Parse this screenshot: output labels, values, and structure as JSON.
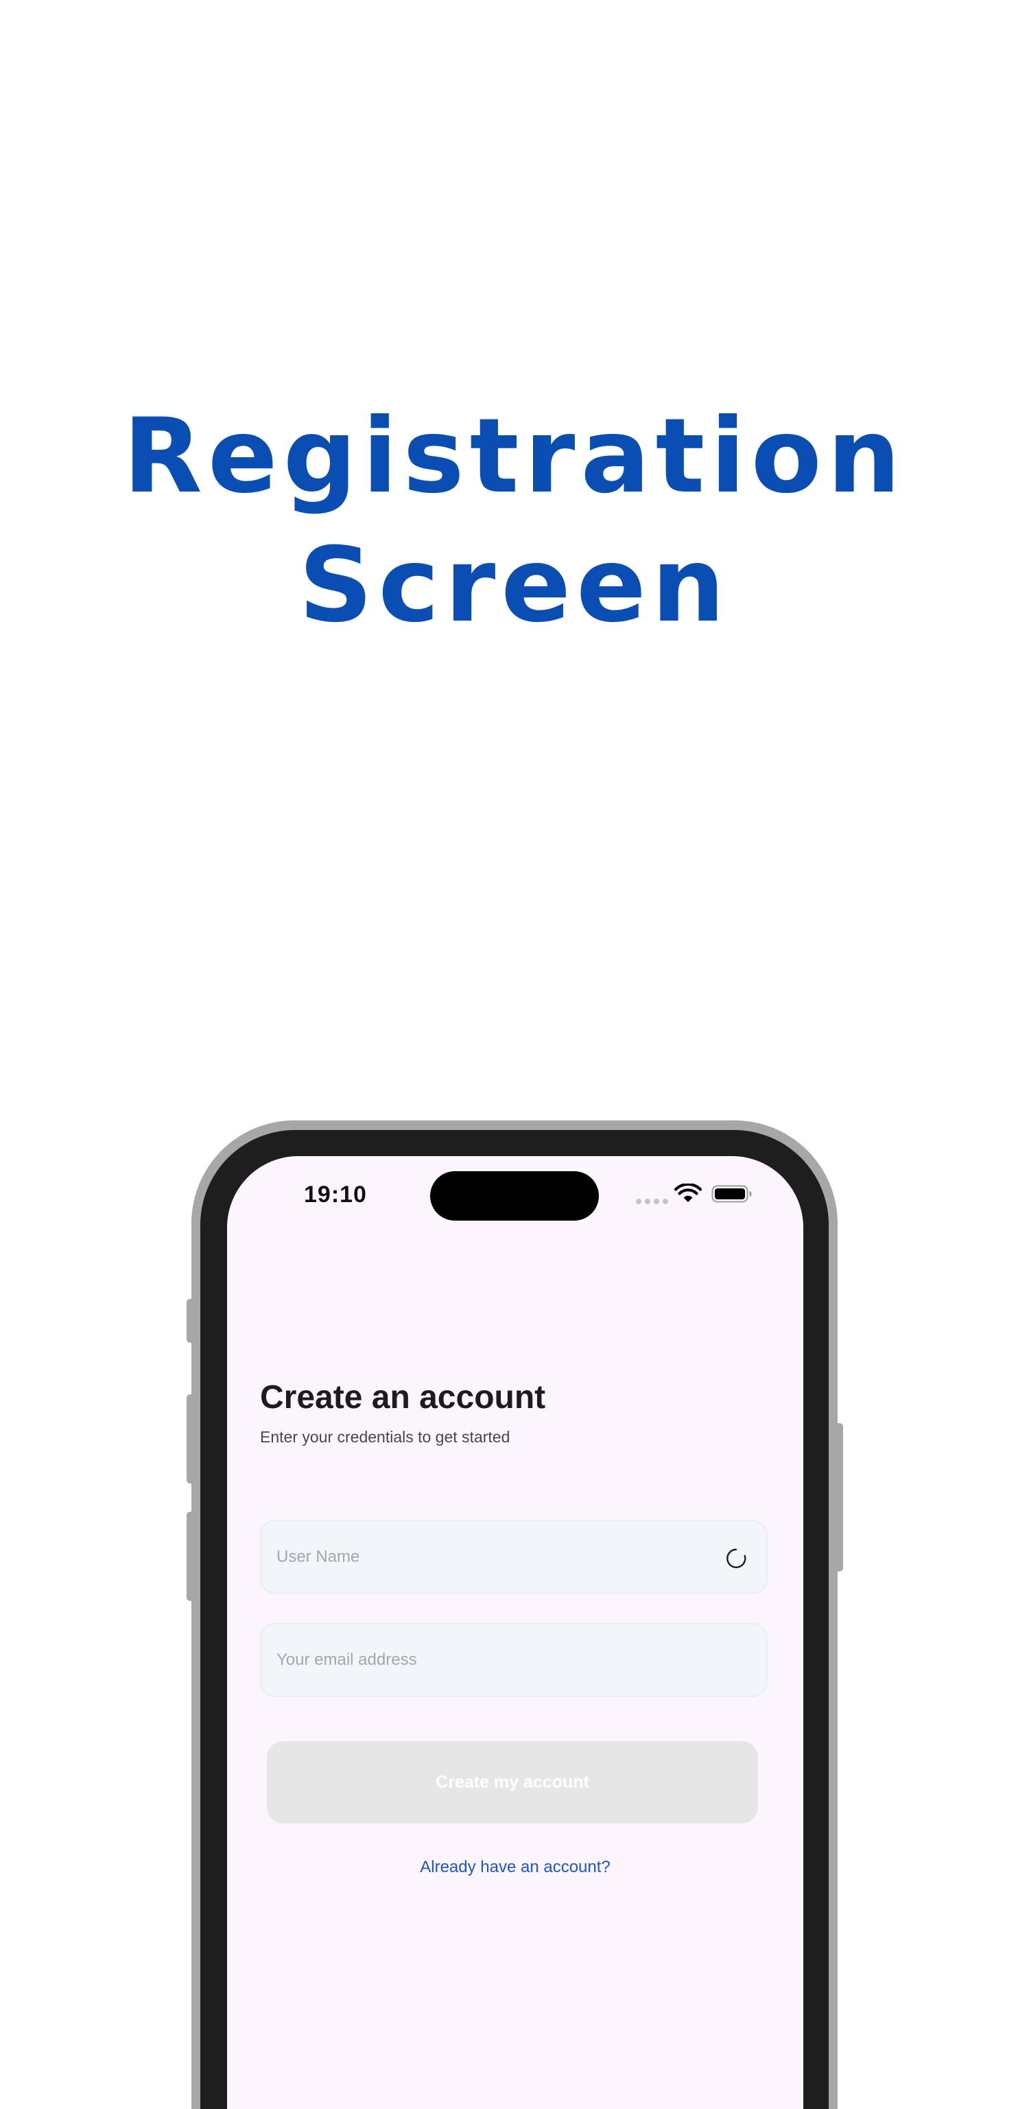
{
  "headline": {
    "line1": "Registration",
    "line2": "Screen"
  },
  "status_bar": {
    "time": "19:10",
    "icons": [
      "signal-dots-icon",
      "wifi-icon",
      "battery-icon"
    ]
  },
  "registration": {
    "title": "Create an account",
    "subtitle": "Enter your credentials to get started",
    "username_field": {
      "placeholder": "User Name",
      "value": "",
      "status_icon": "loading-spinner-icon"
    },
    "email_field": {
      "placeholder": "Your email address",
      "value": ""
    },
    "submit_label": "Create my account",
    "login_link": "Already have an account?"
  },
  "colors": {
    "accent": "#0a4db3",
    "link": "#1a56c8",
    "screen_background": "#fcf5fd",
    "input_background": "#f2f5fa",
    "button_disabled": "#e6e6e6",
    "device_frame": "#1e1e1e"
  }
}
